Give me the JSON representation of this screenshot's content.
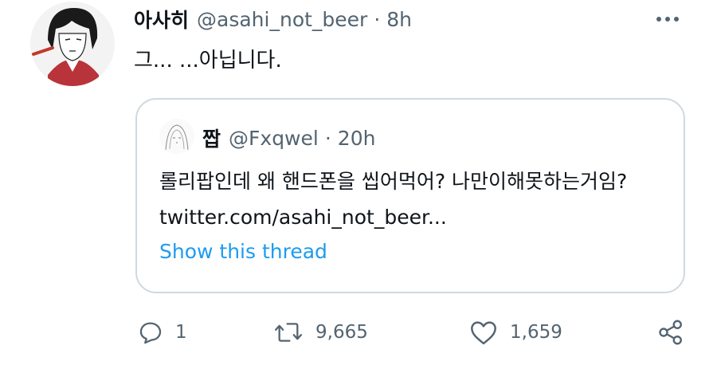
{
  "tweet": {
    "display_name": "아사히",
    "handle": "@asahi_not_beer",
    "separator": "·",
    "time": "8h",
    "text": "그... ...아닙니다."
  },
  "quote": {
    "display_name": "짭",
    "handle": "@Fxqwel",
    "separator": "·",
    "time": "20h",
    "text": "롤리팝인데 왜 핸드폰을 씹어먹어? 나만이해못하는거임? twitter.com/asahi_not_beer...",
    "show_thread": "Show this thread"
  },
  "actions": {
    "reply_count": "1",
    "retweet_count": "9,665",
    "like_count": "1,659"
  },
  "icons": {
    "more": "more-horizontal-icon",
    "reply": "reply-icon",
    "retweet": "retweet-icon",
    "like": "heart-icon",
    "share": "share-icon"
  },
  "colors": {
    "text": "#0f1419",
    "secondary": "#536471",
    "link": "#1d9bf0",
    "border": "#cfd9de"
  }
}
